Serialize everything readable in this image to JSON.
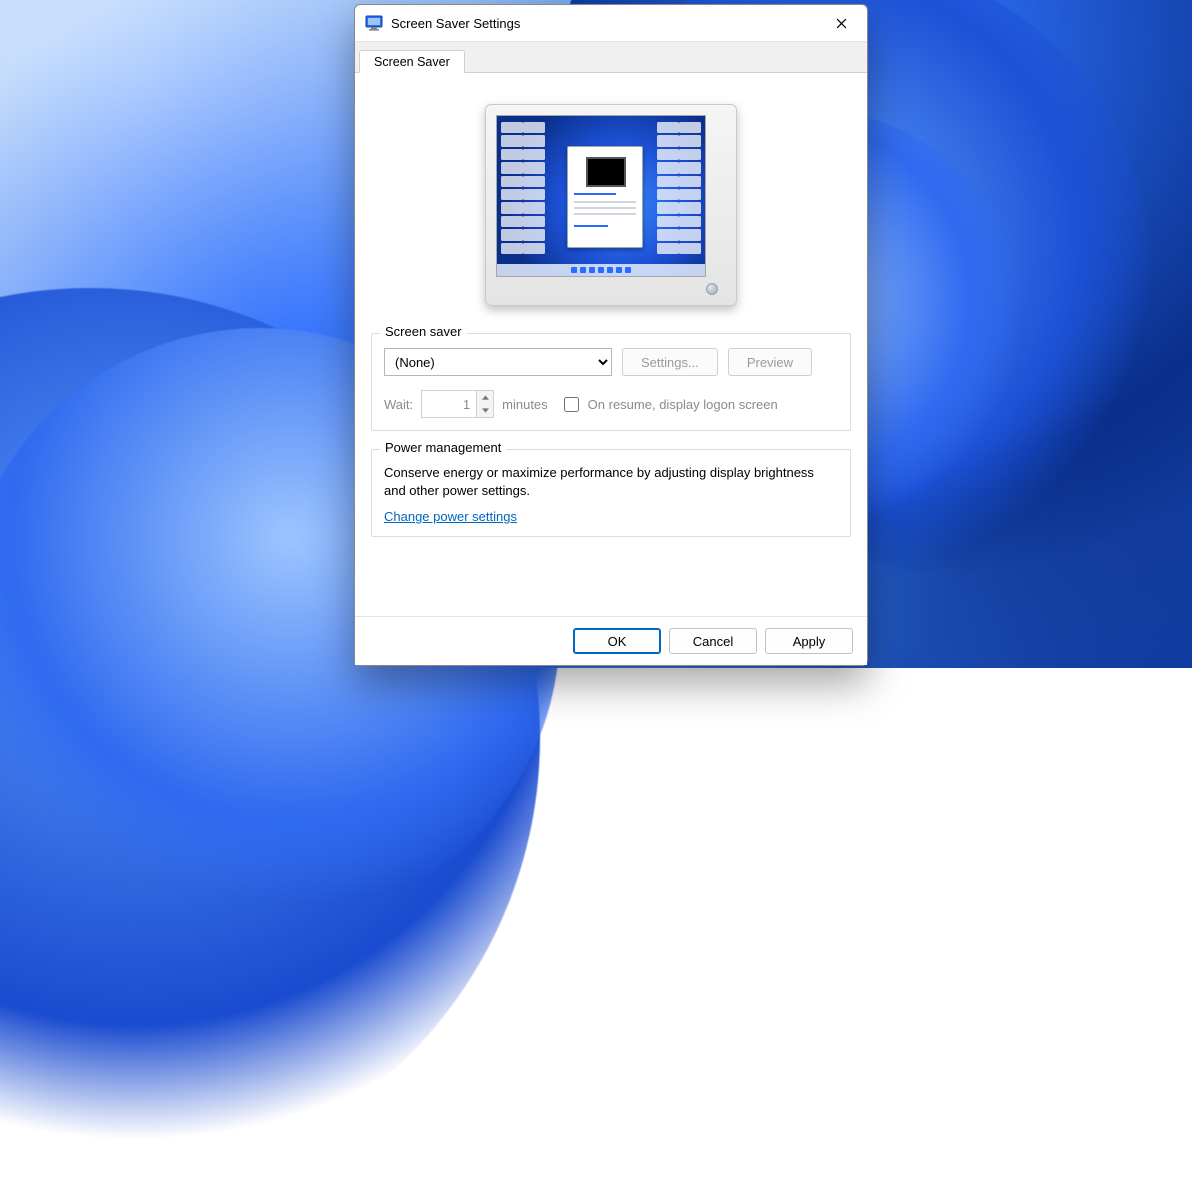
{
  "window": {
    "title": "Screen Saver Settings"
  },
  "tabs": [
    {
      "label": "Screen Saver"
    }
  ],
  "screensaver_group": {
    "legend": "Screen saver",
    "selected": "(None)",
    "options": [
      "(None)"
    ],
    "settings_label": "Settings...",
    "preview_label": "Preview",
    "settings_enabled": false,
    "preview_enabled": false,
    "wait_label": "Wait:",
    "wait_value": "1",
    "wait_units": "minutes",
    "resume_label": "On resume, display logon screen",
    "resume_checked": false
  },
  "power_group": {
    "legend": "Power management",
    "text": "Conserve energy or maximize performance by adjusting display brightness and other power settings.",
    "link": "Change power settings"
  },
  "footer": {
    "ok": "OK",
    "cancel": "Cancel",
    "apply": "Apply"
  }
}
